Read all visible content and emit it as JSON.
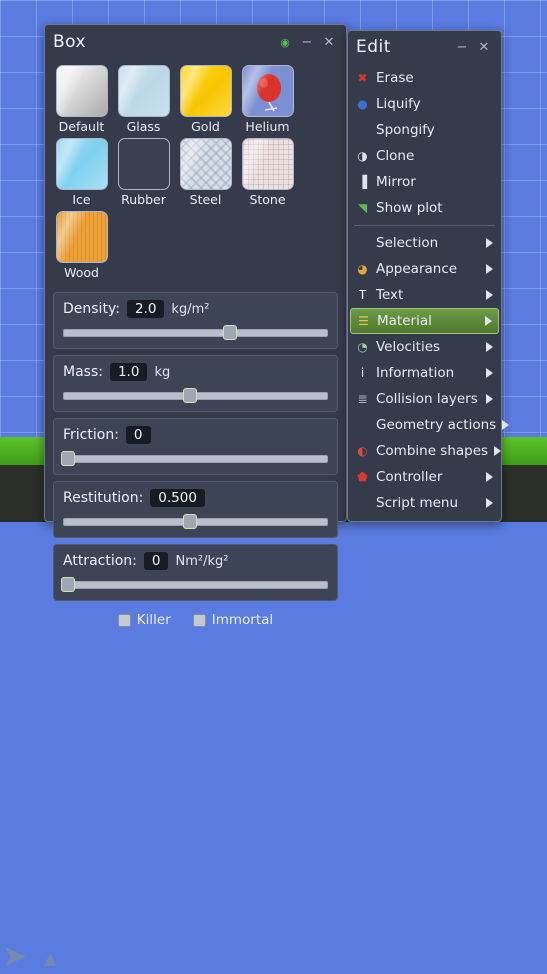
{
  "canvas": {
    "sky_color": "#5a7ce0",
    "ground_color": "#4bb31e",
    "toolbar_color": "#2b2f28",
    "tools": [
      {
        "name": "play-arrow-icon",
        "glyph": "➤"
      },
      {
        "name": "up-triangle-icon",
        "glyph": "▲"
      }
    ]
  },
  "box_window": {
    "title": "Box",
    "controls": [
      {
        "name": "pin-toggle",
        "glyph": "◉"
      },
      {
        "name": "minimize-button",
        "glyph": "−"
      },
      {
        "name": "close-button",
        "glyph": "✕"
      }
    ],
    "materials": [
      {
        "label": "Default",
        "swatch": "sw-default"
      },
      {
        "label": "Glass",
        "swatch": "sw-glass"
      },
      {
        "label": "Gold",
        "swatch": "sw-gold"
      },
      {
        "label": "Helium",
        "swatch": "sw-helium"
      },
      {
        "label": "Ice",
        "swatch": "sw-ice"
      },
      {
        "label": "Rubber",
        "swatch": "sw-rubber"
      },
      {
        "label": "Steel",
        "swatch": "sw-steel"
      },
      {
        "label": "Stone",
        "swatch": "sw-stone"
      },
      {
        "label": "Wood",
        "swatch": "sw-wood"
      }
    ],
    "properties": [
      {
        "label": "Density:",
        "value": "2.0",
        "unit": "kg/m²",
        "handle_pct": 63
      },
      {
        "label": "Mass:",
        "value": "1.0",
        "unit": "kg",
        "handle_pct": 48
      },
      {
        "label": "Friction:",
        "value": "0",
        "unit": "",
        "handle_pct": 2
      },
      {
        "label": "Restitution:",
        "value": "0.500",
        "unit": "",
        "handle_pct": 48
      },
      {
        "label": "Attraction:",
        "value": "0",
        "unit": "Nm²/kg²",
        "handle_pct": 2
      }
    ],
    "flags": [
      {
        "label": "Killer",
        "checked": false
      },
      {
        "label": "Immortal",
        "checked": false
      }
    ]
  },
  "edit_window": {
    "title": "Edit",
    "controls": [
      {
        "name": "minimize-button",
        "glyph": "−"
      },
      {
        "name": "close-button",
        "glyph": "✕"
      }
    ],
    "highlight_color": "#6d9b46",
    "items": [
      {
        "label": "Erase",
        "icon": "erase-x-icon",
        "glyph": "✖",
        "color": "#d8392f",
        "arrow": false
      },
      {
        "label": "Liquify",
        "icon": "water-drop-icon",
        "glyph": "●",
        "color": "#3b6fd8",
        "arrow": false
      },
      {
        "label": "Spongify",
        "icon": "",
        "glyph": "",
        "color": "",
        "arrow": false,
        "indent": true
      },
      {
        "label": "Clone",
        "icon": "clone-icon",
        "glyph": "◑",
        "color": "#dfe4ef",
        "arrow": false
      },
      {
        "label": "Mirror",
        "icon": "mirror-bars-icon",
        "glyph": "▐",
        "color": "#dfe4ef",
        "arrow": false
      },
      {
        "label": "Show plot",
        "icon": "plot-chart-icon",
        "glyph": "◥",
        "color": "#5bbd4a",
        "arrow": false
      },
      {
        "separator": true
      },
      {
        "label": "Selection",
        "icon": "",
        "glyph": "",
        "color": "",
        "arrow": true,
        "indent": true
      },
      {
        "label": "Appearance",
        "icon": "palette-icon",
        "glyph": "◕",
        "color": "#e8a23a",
        "arrow": true
      },
      {
        "label": "Text",
        "icon": "text-t-icon",
        "glyph": "T",
        "color": "#ffffff",
        "arrow": true
      },
      {
        "label": "Material",
        "icon": "material-stack-icon",
        "glyph": "☰",
        "color": "#f0c14b",
        "arrow": true,
        "highlight": true
      },
      {
        "label": "Velocities",
        "icon": "gauge-icon",
        "glyph": "◔",
        "color": "#9fd4a8",
        "arrow": true
      },
      {
        "label": "Information",
        "icon": "info-icon",
        "glyph": "i",
        "color": "#dfe4ef",
        "arrow": true
      },
      {
        "label": "Collision layers",
        "icon": "layers-icon",
        "glyph": "≣",
        "color": "#aab3c6",
        "arrow": true
      },
      {
        "label": "Geometry actions",
        "icon": "",
        "glyph": "",
        "color": "",
        "arrow": true,
        "indent": true
      },
      {
        "label": "Combine shapes",
        "icon": "combine-shapes-icon",
        "glyph": "◐",
        "color": "#e04a3a",
        "arrow": true
      },
      {
        "label": "Controller",
        "icon": "gamepad-icon",
        "glyph": "⬟",
        "color": "#d8392f",
        "arrow": true
      },
      {
        "label": "Script menu",
        "icon": "",
        "glyph": "",
        "color": "",
        "arrow": true,
        "indent": true
      }
    ]
  }
}
